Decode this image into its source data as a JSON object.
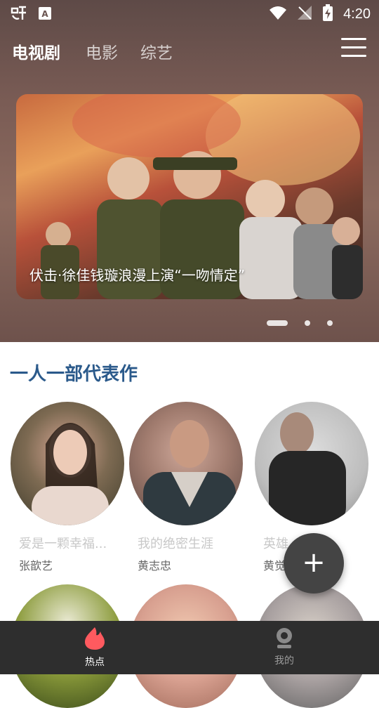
{
  "status_bar": {
    "time": "4:20",
    "icons": [
      "bug-icon",
      "a-icon",
      "wifi-icon",
      "no-signal-icon",
      "battery-charging-icon"
    ]
  },
  "nav": {
    "tabs": [
      {
        "label": "电视剧",
        "active": true
      },
      {
        "label": "电影",
        "active": false
      },
      {
        "label": "综艺",
        "active": false
      }
    ],
    "menu_icon": "hamburger-menu-icon"
  },
  "banner": {
    "caption": "伏击·徐佳钱璇浪漫上演“一吻情定”",
    "page_count": 3,
    "active_page": 1
  },
  "section": {
    "title": "一人一部代表作"
  },
  "cards": [
    {
      "work": "爱是一颗幸福...",
      "actor": "张歆艺"
    },
    {
      "work": "我的绝密生涯",
      "actor": "黄志忠"
    },
    {
      "work": "英雄",
      "actor": "黄觉"
    }
  ],
  "fab": {
    "icon": "plus-icon"
  },
  "bottom_nav": {
    "items": [
      {
        "label": "热点",
        "icon": "flame-icon",
        "active": true
      },
      {
        "label": "我的",
        "icon": "profile-icon",
        "active": false
      }
    ]
  },
  "colors": {
    "section_title": "#2b5a8b",
    "active_tab_icon": "#ff5a5f",
    "bottom_nav_bg": "#2e2e2e"
  }
}
